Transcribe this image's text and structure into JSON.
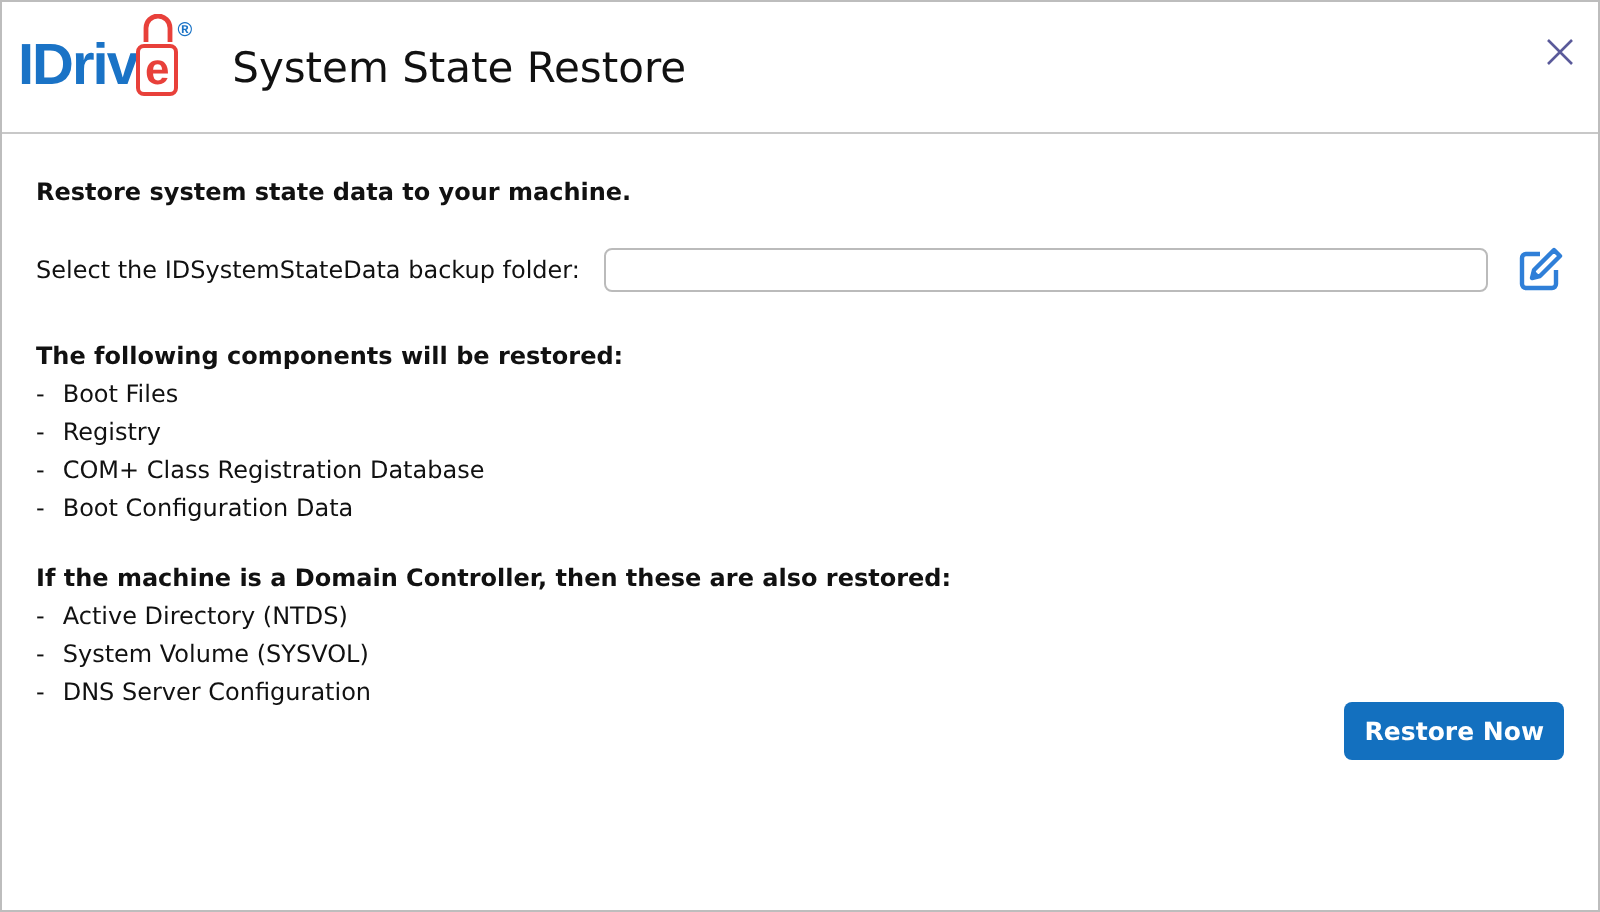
{
  "logo": {
    "main": "IDriv",
    "accent": "e",
    "mark": "®"
  },
  "window": {
    "title": "System State Restore"
  },
  "heading": "Restore system state data to your machine.",
  "folder": {
    "label": "Select the IDSystemStateData backup folder:"
  },
  "sections": [
    {
      "title": "The following components will be restored:",
      "items": [
        "Boot Files",
        "Registry",
        "COM+ Class Registration Database",
        "Boot Configuration Data"
      ]
    },
    {
      "title": "If the machine is a Domain Controller, then these are also restored:",
      "items": [
        "Active Directory (NTDS)",
        "System Volume (SYSVOL)",
        "DNS Server Configuration"
      ]
    }
  ],
  "bullet": "-",
  "buttons": [
    "Restore Now"
  ]
}
